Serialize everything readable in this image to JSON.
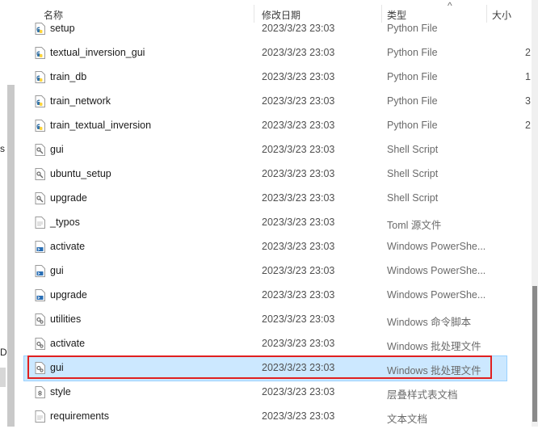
{
  "columns": {
    "name": "名称",
    "date": "修改日期",
    "type": "类型",
    "size": "大小"
  },
  "nav_fragments": [
    "s",
    "D"
  ],
  "files": [
    {
      "name": "setup",
      "date": "2023/3/23 23:03",
      "type": "Python File",
      "size": "",
      "icon": "python-file-icon"
    },
    {
      "name": "textual_inversion_gui",
      "date": "2023/3/23 23:03",
      "type": "Python File",
      "size": "2",
      "icon": "python-file-icon"
    },
    {
      "name": "train_db",
      "date": "2023/3/23 23:03",
      "type": "Python File",
      "size": "1",
      "icon": "python-file-icon"
    },
    {
      "name": "train_network",
      "date": "2023/3/23 23:03",
      "type": "Python File",
      "size": "3",
      "icon": "python-file-icon"
    },
    {
      "name": "train_textual_inversion",
      "date": "2023/3/23 23:03",
      "type": "Python File",
      "size": "2",
      "icon": "python-file-icon"
    },
    {
      "name": "gui",
      "date": "2023/3/23 23:03",
      "type": "Shell Script",
      "size": "",
      "icon": "shell-script-icon"
    },
    {
      "name": "ubuntu_setup",
      "date": "2023/3/23 23:03",
      "type": "Shell Script",
      "size": "",
      "icon": "shell-script-icon"
    },
    {
      "name": "upgrade",
      "date": "2023/3/23 23:03",
      "type": "Shell Script",
      "size": "",
      "icon": "shell-script-icon"
    },
    {
      "name": "_typos",
      "date": "2023/3/23 23:03",
      "type": "Toml 源文件",
      "size": "",
      "icon": "text-file-icon"
    },
    {
      "name": "activate",
      "date": "2023/3/23 23:03",
      "type": "Windows PowerShe...",
      "size": "",
      "icon": "powershell-file-icon"
    },
    {
      "name": "gui",
      "date": "2023/3/23 23:03",
      "type": "Windows PowerShe...",
      "size": "",
      "icon": "powershell-file-icon"
    },
    {
      "name": "upgrade",
      "date": "2023/3/23 23:03",
      "type": "Windows PowerShe...",
      "size": "",
      "icon": "powershell-file-icon"
    },
    {
      "name": "utilities",
      "date": "2023/3/23 23:03",
      "type": "Windows 命令脚本",
      "size": "",
      "icon": "batch-file-icon"
    },
    {
      "name": "activate",
      "date": "2023/3/23 23:03",
      "type": "Windows 批处理文件",
      "size": "",
      "icon": "batch-file-icon"
    },
    {
      "name": "gui",
      "date": "2023/3/23 23:03",
      "type": "Windows 批处理文件",
      "size": "",
      "icon": "batch-file-icon",
      "selected": true
    },
    {
      "name": "style",
      "date": "2023/3/23 23:03",
      "type": "层叠样式表文档",
      "size": "",
      "icon": "css-file-icon"
    },
    {
      "name": "requirements",
      "date": "2023/3/23 23:03",
      "type": "文本文档",
      "size": "",
      "icon": "text-file-icon"
    }
  ],
  "colors": {
    "selection": "#cce8ff",
    "highlight_box": "#e02020",
    "python_blue": "#3572a5",
    "python_yellow": "#ffd43b"
  }
}
